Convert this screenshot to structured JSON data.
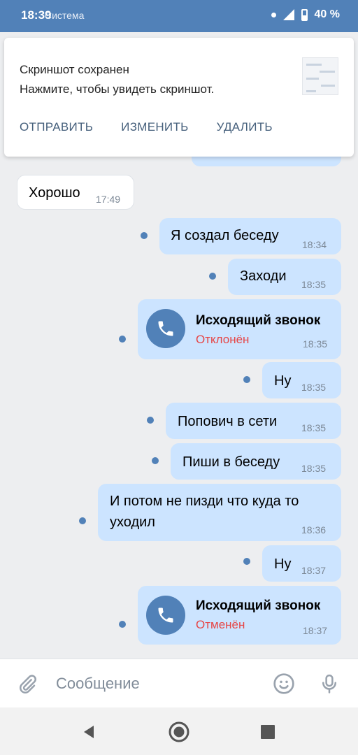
{
  "status_bar": {
    "time": "18:39",
    "source": "Система",
    "battery": "40 %"
  },
  "notification": {
    "title": "Скриншот сохранен",
    "text": "Нажмите, чтобы увидеть скриншот.",
    "actions": [
      "ОТПРАВИТЬ",
      "ИЗМЕНИТЬ",
      "УДАЛИТЬ"
    ]
  },
  "messages": [
    {
      "text": "Хорошо",
      "time": "17:49"
    },
    {
      "text": "Я создал беседу",
      "time": "18:34"
    },
    {
      "text": "Заходи",
      "time": "18:35"
    },
    {
      "call_title": "Исходящий звонок",
      "call_status": "Отклонён",
      "time": "18:35"
    },
    {
      "text": "Ну",
      "time": "18:35"
    },
    {
      "text": "Попович в сети",
      "time": "18:35"
    },
    {
      "text": "Пиши в беседу",
      "time": "18:35"
    },
    {
      "text_line1": "И потом не пизди что куда то",
      "text_line2": "уходил",
      "time": "18:36"
    },
    {
      "text": "Ну",
      "time": "18:37"
    },
    {
      "call_title": "Исходящий звонок",
      "call_status": "Отменён",
      "time": "18:37"
    }
  ],
  "composer": {
    "placeholder": "Сообщение"
  },
  "colors": {
    "accent": "#5181b8",
    "outgoing_bubble": "#cce4ff",
    "incoming_bubble": "#ffffff",
    "declined": "#e64646",
    "background": "#edeef0"
  }
}
